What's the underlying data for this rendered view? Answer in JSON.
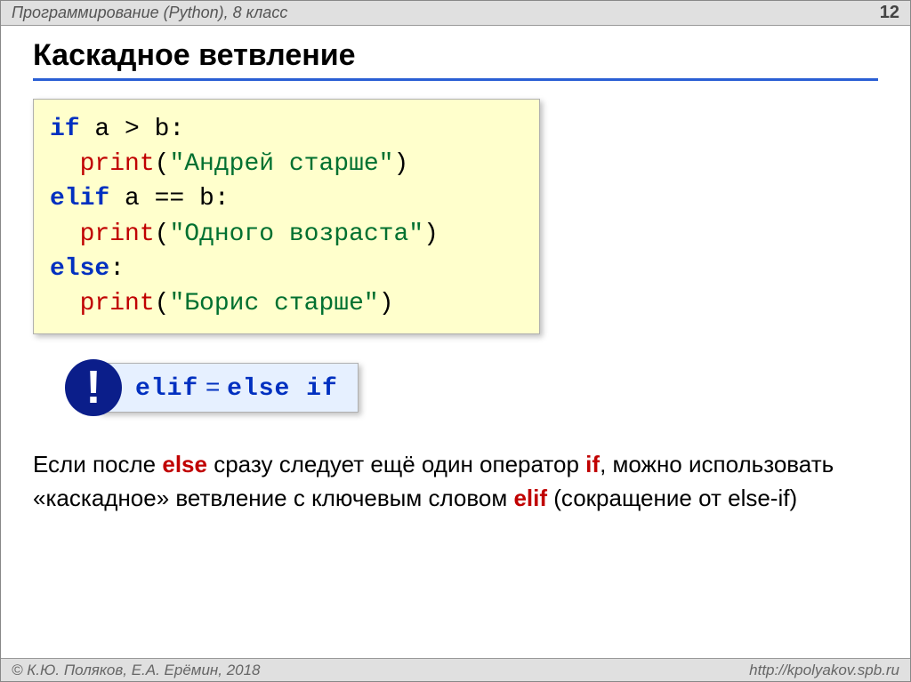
{
  "header": {
    "course": "Программирование (Python), 8 класс",
    "page": "12"
  },
  "title": "Каскадное ветвление",
  "code": {
    "l1": {
      "kw": "if",
      "rest": " a > b:"
    },
    "l2": {
      "fn": "print",
      "open": "(",
      "str": "\"Андрей старше\"",
      "close": ")"
    },
    "l3": {
      "kw": "elif",
      "rest": " a == b:"
    },
    "l4": {
      "fn": "print",
      "open": "(",
      "str": "\"Одного возраста\"",
      "close": ")"
    },
    "l5": {
      "kw": "else",
      "rest": ":"
    },
    "l6": {
      "fn": "print",
      "open": "(",
      "str": "\"Борис старше\"",
      "close": ")"
    },
    "indent": "  "
  },
  "callout": {
    "badge": "!",
    "lhs": "elif",
    "eq": " = ",
    "rhs": "else if"
  },
  "para": {
    "t1": "Если после ",
    "else": "else",
    "t2": " сразу следует ещё один оператор ",
    "if": "if",
    "t3": ", можно использовать «каскадное» ветвление с ключевым словом ",
    "elif": "elif",
    "t4": " (сокращение от else-if)"
  },
  "footer": {
    "left": "© К.Ю. Поляков, Е.А. Ерёмин, 2018",
    "right": "http://kpolyakov.spb.ru"
  }
}
